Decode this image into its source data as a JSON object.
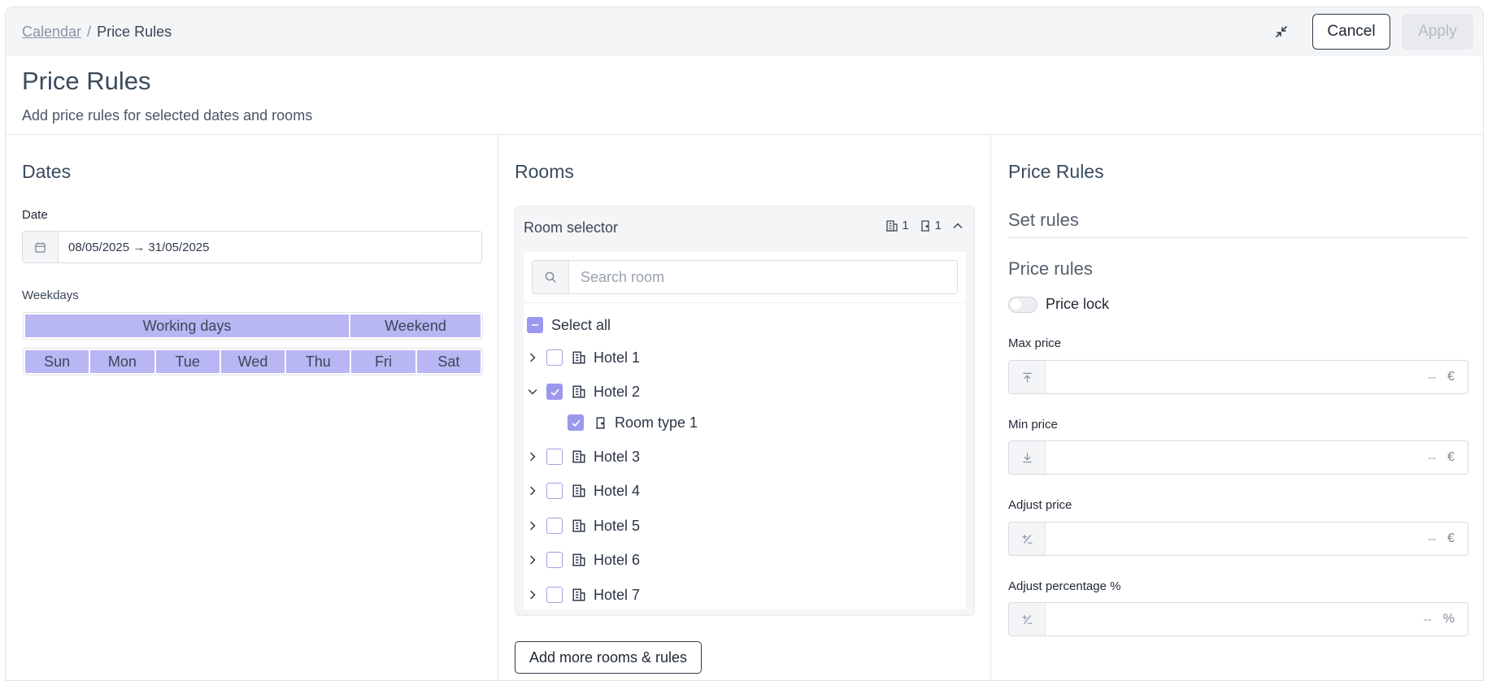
{
  "breadcrumb": {
    "parent": "Calendar",
    "separator": "/",
    "current": "Price Rules"
  },
  "actions": {
    "cancel": "Cancel",
    "apply": "Apply"
  },
  "header": {
    "title": "Price Rules",
    "subtitle": "Add price rules for selected dates and rooms"
  },
  "dates": {
    "title": "Dates",
    "date_label": "Date",
    "date_value": "08/05/2025 → 31/05/2025",
    "weekdays_label": "Weekdays",
    "groups": [
      "Working days",
      "Weekend"
    ],
    "days": [
      "Sun",
      "Mon",
      "Tue",
      "Wed",
      "Thu",
      "Fri",
      "Sat"
    ]
  },
  "rooms": {
    "title": "Rooms",
    "selector_title": "Room selector",
    "hotel_count": "1",
    "room_count": "1",
    "search_placeholder": "Search room",
    "select_all": "Select all",
    "hotels": [
      {
        "label": "Hotel 1",
        "expanded": false,
        "checked": false
      },
      {
        "label": "Hotel 2",
        "expanded": true,
        "checked": true
      },
      {
        "label": "Hotel 3",
        "expanded": false,
        "checked": false
      },
      {
        "label": "Hotel 4",
        "expanded": false,
        "checked": false
      },
      {
        "label": "Hotel 5",
        "expanded": false,
        "checked": false
      },
      {
        "label": "Hotel 6",
        "expanded": false,
        "checked": false
      },
      {
        "label": "Hotel 7",
        "expanded": false,
        "checked": false
      }
    ],
    "room_type": "Room type 1",
    "add_more": "Add more rooms & rules"
  },
  "rules": {
    "title": "Price Rules",
    "set_rules": "Set rules",
    "price_rules": "Price rules",
    "price_lock": "Price lock",
    "fields": [
      {
        "label": "Max price",
        "placeholder": "--",
        "unit": "€",
        "icon": "arrow-up-to-line-icon"
      },
      {
        "label": "Min price",
        "placeholder": "--",
        "unit": "€",
        "icon": "arrow-down-to-line-icon"
      },
      {
        "label": "Adjust price",
        "placeholder": "--",
        "unit": "€",
        "icon": "plus-minus-icon"
      },
      {
        "label": "Adjust percentage %",
        "placeholder": "--",
        "unit": "%",
        "icon": "plus-minus-icon"
      }
    ]
  },
  "colors": {
    "accent": "#9c98ee",
    "weekday_fill": "#b9b6f4",
    "text": "#2f3a4a"
  }
}
